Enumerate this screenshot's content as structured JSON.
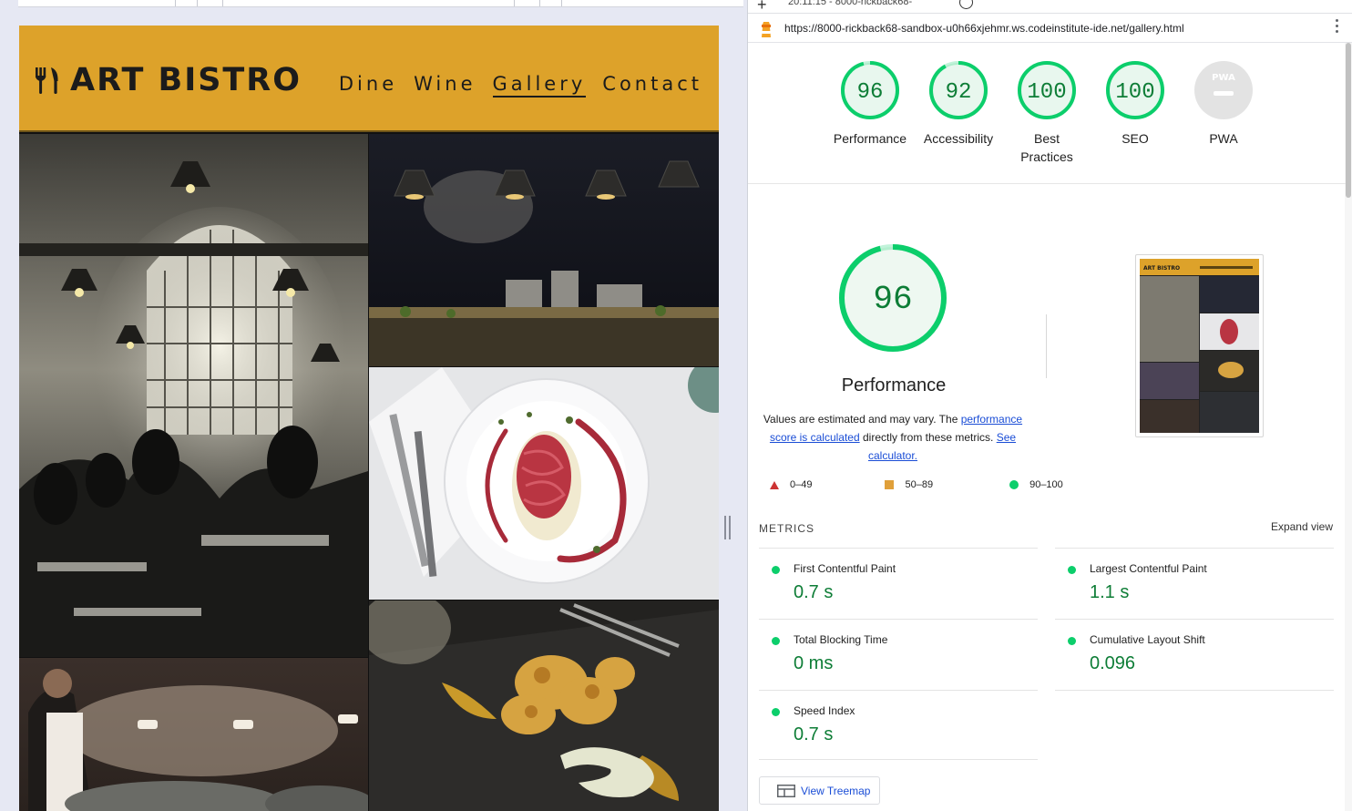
{
  "browser": {
    "tab_label": "20:11:15 - 8000-rickback68-",
    "url": "https://8000-rickback68-sandbox-u0h66xjehmr.ws.codeinstitute-ide.net/gallery.html"
  },
  "site": {
    "brand": "ART BISTRO",
    "nav": [
      "Dine",
      "Wine",
      "Gallery",
      "Contact"
    ],
    "active_nav": "Gallery",
    "header_color": "#dda22a"
  },
  "lighthouse": {
    "categories": [
      {
        "label": "Performance",
        "score": "96"
      },
      {
        "label": "Accessibility",
        "score": "92"
      },
      {
        "label": "Best Practices",
        "score": "100"
      },
      {
        "label": "SEO",
        "score": "100"
      },
      {
        "label": "PWA",
        "score": ""
      }
    ],
    "pwa_badge": "PWA",
    "featured": {
      "score": "96",
      "title": "Performance",
      "desc_prefix": "Values are estimated and may vary. The ",
      "desc_link1": "performance score is calculated",
      "desc_mid": " directly from these metrics. ",
      "desc_link2": "See calculator."
    },
    "legend": [
      {
        "range": "0–49",
        "shape": "triangle",
        "color": "#cc3333"
      },
      {
        "range": "50–89",
        "shape": "square",
        "color": "#e0a03a"
      },
      {
        "range": "90–100",
        "shape": "circle",
        "color": "#0cce6b"
      }
    ],
    "metrics_title": "METRICS",
    "expand_label": "Expand view",
    "metrics": [
      {
        "name": "First Contentful Paint",
        "value": "0.7 s"
      },
      {
        "name": "Largest Contentful Paint",
        "value": "1.1 s"
      },
      {
        "name": "Total Blocking Time",
        "value": "0 ms"
      },
      {
        "name": "Cumulative Layout Shift",
        "value": "0.096"
      },
      {
        "name": "Speed Index",
        "value": "0.7 s"
      }
    ],
    "treemap_label": "View Treemap",
    "colors": {
      "pass": "#0cce6b",
      "pass_text": "#0d7d36",
      "pass_bg": "#e8f7ee",
      "link": "#1a4dd6"
    }
  }
}
